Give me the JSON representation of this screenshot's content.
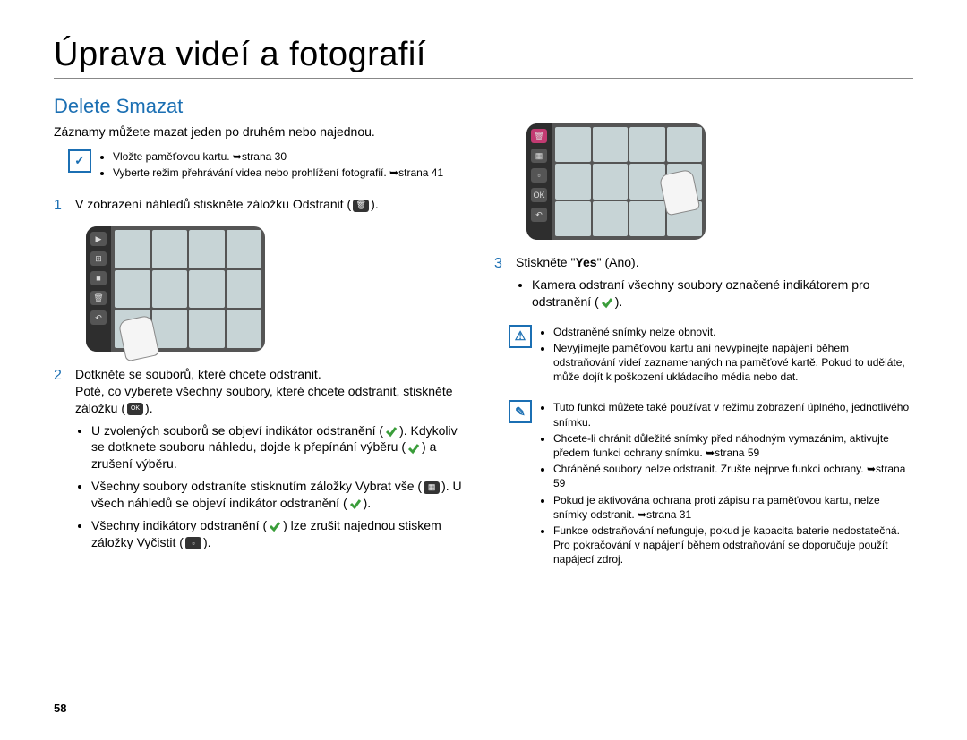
{
  "page_number": "58",
  "title": "Úprava videí a fotografií",
  "section_title": "Delete Smazat",
  "intro": "Záznamy můžete mazat jeden po druhém nebo najednou.",
  "top_note": [
    "Vložte paměťovou kartu. ➥strana 30",
    "Vyberte režim přehrávání videa nebo prohlížení fotografií. ➥strana 41"
  ],
  "step1": {
    "num": "1",
    "text_a": "V zobrazení náhledů stiskněte záložku Odstranit (",
    "text_b": ")."
  },
  "step2": {
    "num": "2",
    "line1": "Dotkněte se souborů, které chcete odstranit.",
    "line2_a": "Poté, co vyberete všechny soubory, které chcete odstranit, stiskněte záložku (",
    "line2_b": ").",
    "b1_a": "U zvolených souborů se objeví indikátor odstranění (",
    "b1_b": "). Kdykoliv se dotknete souboru náhledu, dojde k přepínání výběru (",
    "b1_c": ") a zrušení výběru.",
    "b2_a": "Všechny soubory odstraníte stisknutím záložky Vybrat vše (",
    "b2_b": "). U všech náhledů se objeví indikátor odstranění (",
    "b2_c": ").",
    "b3_a": "Všechny indikátory odstranění (",
    "b3_b": ") lze zrušit najednou stiskem záložky Vyčistit (",
    "b3_c": ")."
  },
  "step3": {
    "num": "3",
    "line1_a": "Stiskněte \"",
    "line1_yes": "Yes",
    "line1_b": "\" (Ano).",
    "b1_a": "Kamera odstraní všechny soubory označené indikátorem pro odstranění (",
    "b1_b": ")."
  },
  "warn_note": [
    "Odstraněné snímky nelze obnovit.",
    "Nevyjímejte paměťovou kartu ani nevypínejte napájení během odstraňování videí zaznamenaných na paměťové kartě. Pokud to uděláte, může dojít k poškození ukládacího média nebo dat."
  ],
  "info_note": [
    "Tuto funkci můžete také používat v režimu zobrazení úplného, jednotlivého snímku.",
    "Chcete-li chránit důležité snímky před náhodným vymazáním, aktivujte předem funkci ochrany snímku. ➥strana 59",
    "Chráněné soubory nelze odstranit. Zrušte nejprve funkci ochrany. ➥strana 59",
    "Pokud je aktivována ochrana proti zápisu na paměťovou kartu, nelze snímky odstranit. ➥strana 31",
    "Funkce odstraňování nefunguje, pokud je kapacita baterie nedostatečná. Pro pokračování v napájení během odstraňování se doporučuje použít napájecí zdroj."
  ],
  "sidebar_left": [
    "▶",
    "⊞",
    "■",
    "🗑",
    "↶"
  ],
  "sidebar_right": [
    "🗑",
    "▦",
    "▫",
    "OK",
    "↶"
  ]
}
